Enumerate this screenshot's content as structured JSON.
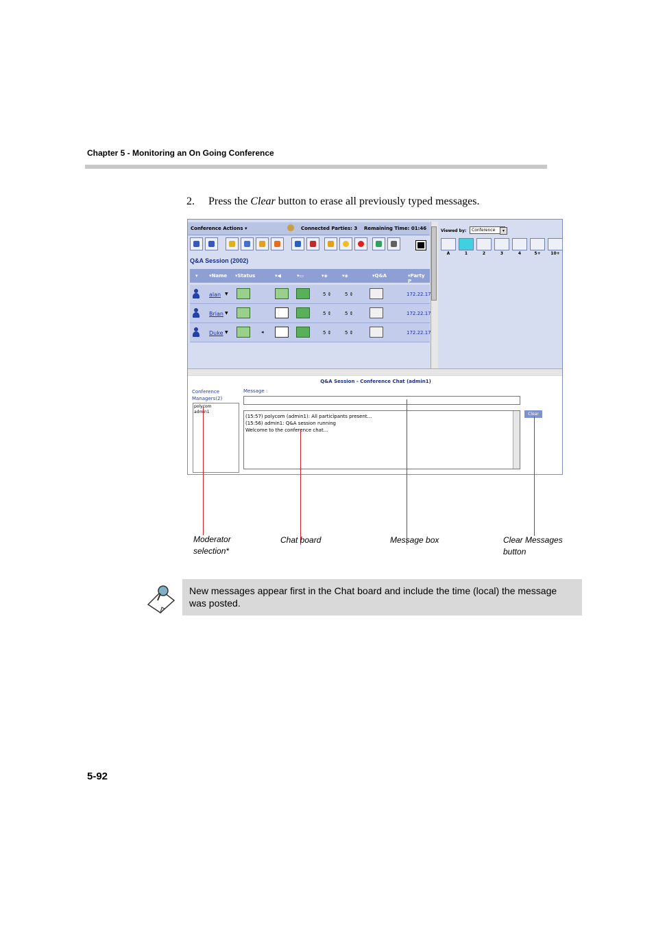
{
  "header": {
    "chapter": "Chapter 5 - Monitoring an On Going Conference"
  },
  "step": {
    "number": "2.",
    "before": "Press the ",
    "emphasis": "Clear",
    "after": " button to erase all previously typed messages."
  },
  "screenshot": {
    "topbar": {
      "actions": "Conference Actions  ▾",
      "parties": "Connected Parties: 3",
      "remaining": "Remaining Time: 01:46"
    },
    "session_title": "Q&A Session (2002)",
    "columns": [
      "Name",
      "Status",
      "",
      "",
      "",
      "",
      "Q&A",
      "Party P"
    ],
    "rows": [
      {
        "name": "alan",
        "v1": "5 ⇕",
        "v2": "5 ⇕",
        "ip": "172.22.17"
      },
      {
        "name": "Brian",
        "v1": "5 ⇕",
        "v2": "5 ⇕",
        "ip": "172.22.17"
      },
      {
        "name": "Duke",
        "v1": "5 ⇕",
        "v2": "5 ⇕",
        "ip": "172.22.17"
      }
    ],
    "viewed_by_label": "Viewed by:",
    "viewed_by_value": "Conference",
    "layouts": [
      "A",
      "1",
      "2",
      "3",
      "4",
      "5+",
      "10+"
    ],
    "chat": {
      "title": "Q&A Session - Conference Chat (admin1)",
      "managers_label_1": "Conference",
      "managers_label_2": "Managers(2)",
      "managers": [
        "polycom",
        "admin1"
      ],
      "message_label": "Message :",
      "messages": [
        "(15:57) polycom (admin1): All participants present...",
        "(15:56) admin1: Q&A session running",
        "Welcome to the conference chat..."
      ],
      "clear_label": "Clear"
    }
  },
  "callouts": {
    "moderator_1": "Moderator",
    "moderator_2": "selection*",
    "chat_board": "Chat board",
    "message_box": "Message box",
    "clear_1": "Clear Messages",
    "clear_2": "button"
  },
  "note": {
    "text": "New messages appear first in the Chat board and include the time (local) the message was posted."
  },
  "page_number": "5-92"
}
